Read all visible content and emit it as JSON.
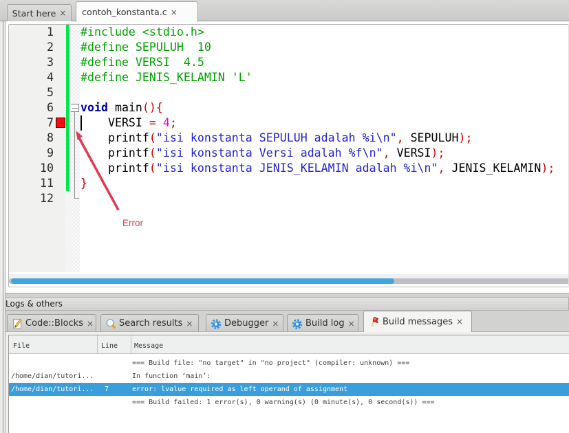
{
  "colors": {
    "accent_blue": "#399fdc",
    "changebar_green": "#00e64c",
    "error_marker_red": "#f60c0c",
    "annotation_red": "#d6365a",
    "preprocessor_green": "#00a000",
    "keyword_blue": "#0000a0",
    "string_blue": "#2323ce",
    "operator_red": "#cc0000",
    "number_magenta": "#e000e0"
  },
  "editor_tabs": [
    {
      "label": "Start here",
      "close": "×",
      "active": false
    },
    {
      "label": "contoh_konstanta.c",
      "close": "×",
      "active": true
    }
  ],
  "editor": {
    "caret_line": 7,
    "error_marker_line": 7,
    "lines": [
      {
        "num": 1,
        "tokens": [
          [
            "pp",
            "#include <stdio.h>"
          ]
        ]
      },
      {
        "num": 2,
        "tokens": [
          [
            "pp",
            "#define SEPULUH  10"
          ]
        ]
      },
      {
        "num": 3,
        "tokens": [
          [
            "pp",
            "#define VERSI  4.5"
          ]
        ]
      },
      {
        "num": 4,
        "tokens": [
          [
            "pp",
            "#define JENIS_KELAMIN 'L'"
          ]
        ]
      },
      {
        "num": 5,
        "tokens": []
      },
      {
        "num": 6,
        "tokens": [
          [
            "kw",
            "void"
          ],
          [
            "id",
            " main"
          ],
          [
            "op",
            "(){"
          ]
        ]
      },
      {
        "num": 7,
        "tokens": [
          [
            "id",
            "    VERSI "
          ],
          [
            "op",
            "="
          ],
          [
            "id",
            " "
          ],
          [
            "num",
            "4"
          ],
          [
            "op",
            ";"
          ]
        ]
      },
      {
        "num": 8,
        "tokens": [
          [
            "id",
            "    printf"
          ],
          [
            "op",
            "("
          ],
          [
            "str",
            "\"isi konstanta SEPULUH adalah %i\\n\""
          ],
          [
            "op",
            ","
          ],
          [
            "id",
            " SEPULUH"
          ],
          [
            "op",
            ");"
          ]
        ]
      },
      {
        "num": 9,
        "tokens": [
          [
            "id",
            "    printf"
          ],
          [
            "op",
            "("
          ],
          [
            "str",
            "\"isi konstanta Versi adalah %f\\n\""
          ],
          [
            "op",
            ","
          ],
          [
            "id",
            " VERSI"
          ],
          [
            "op",
            ");"
          ]
        ]
      },
      {
        "num": 10,
        "tokens": [
          [
            "id",
            "    printf"
          ],
          [
            "op",
            "("
          ],
          [
            "str",
            "\"isi konstanta JENIS_KELAMIN adalah %i\\n\""
          ],
          [
            "op",
            ","
          ],
          [
            "id",
            " JENIS_KELAMIN"
          ],
          [
            "op",
            ");"
          ]
        ]
      },
      {
        "num": 11,
        "tokens": [
          [
            "op",
            "}"
          ]
        ]
      },
      {
        "num": 12,
        "tokens": []
      }
    ]
  },
  "annotation": {
    "label": "Error"
  },
  "logs": {
    "caption": "Logs & others",
    "tabs": [
      {
        "label": "Code::Blocks",
        "close": "×",
        "icon": "codeblocks-icon",
        "active": false
      },
      {
        "label": "Search results",
        "close": "×",
        "icon": "search-icon",
        "active": false
      },
      {
        "label": "Debugger",
        "close": "×",
        "icon": "gear-icon",
        "active": false
      },
      {
        "label": "Build log",
        "close": "×",
        "icon": "gear-icon",
        "active": false
      },
      {
        "label": "Build messages",
        "close": "×",
        "icon": "flag-icon",
        "active": true
      }
    ],
    "table": {
      "headers": [
        "File",
        "Line",
        "Message"
      ],
      "rows": [
        {
          "file": "",
          "line": "",
          "message": "=== Build file: \"no target\" in \"no project\" (compiler: unknown) ===",
          "selected": false
        },
        {
          "file": "/home/dian/tutori...",
          "line": "",
          "message": "In function ‘main’:",
          "selected": false
        },
        {
          "file": "/home/dian/tutori...",
          "line": "7",
          "message": "error: lvalue required as left operand of assignment",
          "selected": true
        },
        {
          "file": "",
          "line": "",
          "message": "=== Build failed: 1 error(s), 0 warning(s) (0 minute(s), 0 second(s)) ===",
          "selected": false
        }
      ]
    }
  }
}
